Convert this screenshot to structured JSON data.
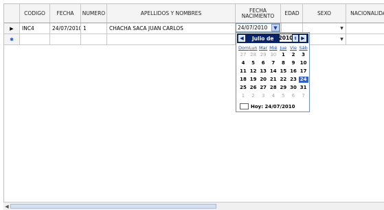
{
  "columns": [
    "CODIGO",
    "FECHA",
    "NUMERO",
    "APELLIDOS Y NOMBRES",
    "FECHA NACIMIENTO",
    "EDAD",
    "SEXO",
    "NACIONALIDAD"
  ],
  "rows": [
    {
      "indicator": "▶",
      "codigo": "INC4",
      "fecha": "24/07/2010",
      "numero": "1",
      "nombres": "CHACHA SACA JUAN CARLOS",
      "fecha_nacimiento": "24/07/2010",
      "edad": "",
      "sexo": "",
      "nacionalidad": ""
    },
    {
      "indicator": "✱",
      "codigo": "",
      "fecha": "",
      "numero": "",
      "nombres": "",
      "fecha_nacimiento": "",
      "edad": "",
      "sexo": "",
      "nacionalidad": ""
    }
  ],
  "calendar": {
    "month_label": "Julio de",
    "year": "2010",
    "weekdays": [
      "Dom",
      "Lun",
      "Mar",
      "Mié",
      "Jue",
      "Vie",
      "Sáb"
    ],
    "weeks": [
      [
        "27",
        "28",
        "29",
        "30",
        "1",
        "2",
        "3"
      ],
      [
        "4",
        "5",
        "6",
        "7",
        "8",
        "9",
        "10"
      ],
      [
        "11",
        "12",
        "13",
        "14",
        "15",
        "16",
        "17"
      ],
      [
        "18",
        "19",
        "20",
        "21",
        "22",
        "23",
        "24"
      ],
      [
        "25",
        "26",
        "27",
        "28",
        "29",
        "30",
        "31"
      ],
      [
        "1",
        "2",
        "3",
        "4",
        "5",
        "6",
        "7"
      ]
    ],
    "selected_day": "24",
    "today_label": "Hoy: 24/07/2010"
  },
  "icons": {
    "dropdown": "chevron-down-icon",
    "prev": "chevron-left-icon",
    "next": "chevron-right-icon"
  }
}
